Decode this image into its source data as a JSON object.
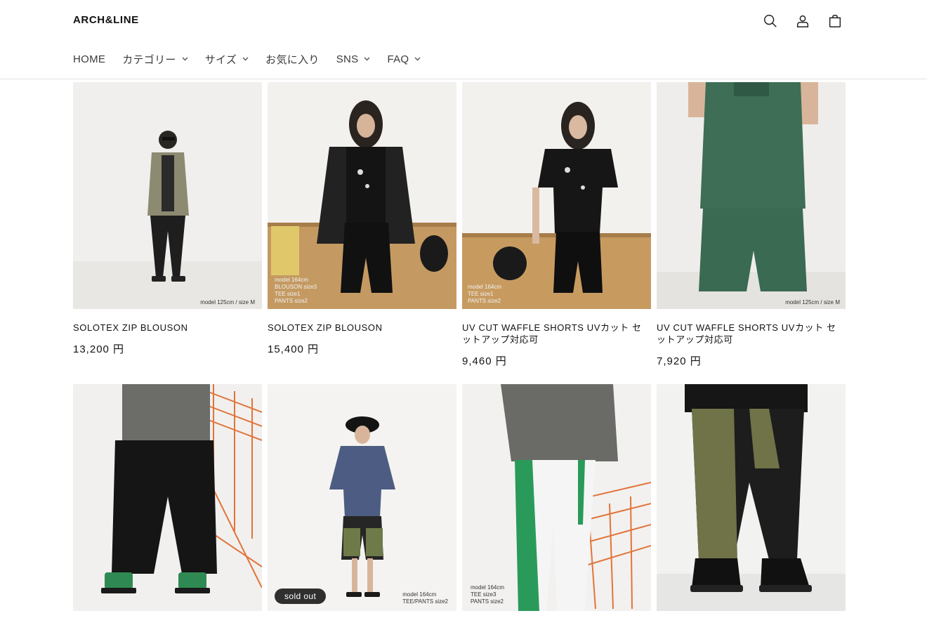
{
  "header": {
    "logo": "ARCH&LINE",
    "icons": [
      "search-icon",
      "account-icon",
      "cart-icon"
    ]
  },
  "nav": {
    "items": [
      {
        "label": "HOME",
        "dropdown": false
      },
      {
        "label": "カテゴリー",
        "dropdown": true
      },
      {
        "label": "サイズ",
        "dropdown": true
      },
      {
        "label": "お気に入り",
        "dropdown": false
      },
      {
        "label": "SNS",
        "dropdown": true
      },
      {
        "label": "FAQ",
        "dropdown": true
      }
    ]
  },
  "products": [
    {
      "title": "SOLOTEX ZIP BLOUSON",
      "price": "13,200 円",
      "caption": "model 125cm / size M"
    },
    {
      "title": "SOLOTEX ZIP BLOUSON",
      "price": "15,400 円",
      "caption": "model 164cm\nBLOUSON size3\nTEE size1\nPANTS size2"
    },
    {
      "title": "UV CUT WAFFLE SHORTS UVカット セットアップ対応可",
      "price": "9,460 円",
      "caption": "model 164cm\nTEE size1\nPANTS size2"
    },
    {
      "title": "UV CUT WAFFLE SHORTS UVカット セットアップ対応可",
      "price": "7,920 円",
      "caption": "model 125cm / size M"
    },
    {
      "title": "",
      "price": "",
      "caption": ""
    },
    {
      "title": "",
      "price": "",
      "caption": "model 164cm\nTEE/PANTS size2",
      "badge": "sold out"
    },
    {
      "title": "",
      "price": "",
      "caption": "model 164cm\nTEE size3\nPANTS size2"
    },
    {
      "title": "",
      "price": "",
      "caption": ""
    }
  ],
  "colors": {
    "text": "#121212",
    "badge_bg": "#2f2f2f",
    "border": "#e4e4e4"
  }
}
